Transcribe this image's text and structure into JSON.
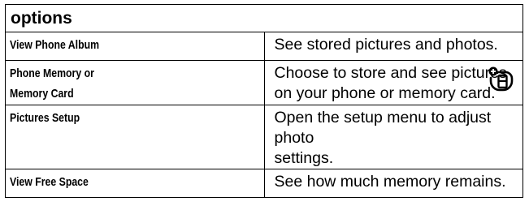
{
  "table": {
    "header": "options",
    "rows": [
      {
        "name": [
          "View Phone Album"
        ],
        "description": [
          "See stored pictures and photos."
        ]
      },
      {
        "name": [
          "Phone Memory or",
          "Memory Card"
        ],
        "description": [
          "Choose to store and see pictures",
          "on your phone or memory card."
        ],
        "icon": "memory-card-feature-icon"
      },
      {
        "name": [
          "Pictures Setup"
        ],
        "description": [
          "Open the setup menu to adjust photo",
          "settings."
        ]
      },
      {
        "name": [
          "View Free Space"
        ],
        "description": [
          "See how much memory remains."
        ]
      }
    ]
  }
}
